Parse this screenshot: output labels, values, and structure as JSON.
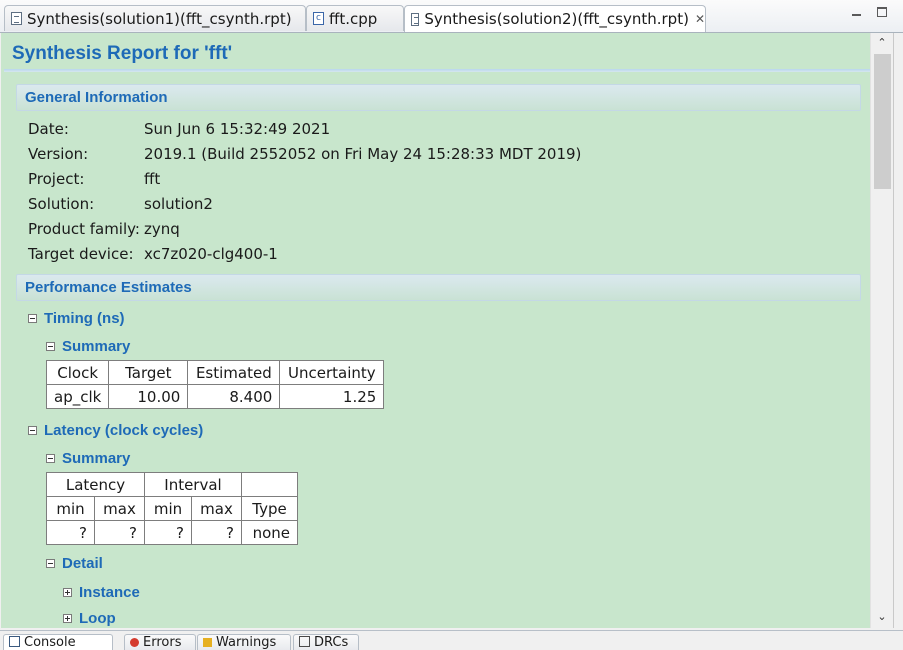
{
  "tabs": [
    {
      "label": "Synthesis(solution1)(fft_csynth.rpt)",
      "icon": "report-icon",
      "active": false
    },
    {
      "label": "fft.cpp",
      "icon": "cpp-file-icon",
      "active": false
    },
    {
      "label": "Synthesis(solution2)(fft_csynth.rpt)",
      "icon": "report-icon",
      "active": true,
      "close": "✕"
    }
  ],
  "report": {
    "title": "Synthesis Report for 'fft'",
    "general": {
      "heading": "General Information",
      "rows": [
        {
          "label": "Date:",
          "value": "Sun Jun 6 15:32:49 2021"
        },
        {
          "label": "Version:",
          "value": "2019.1 (Build 2552052 on Fri May 24 15:28:33 MDT 2019)"
        },
        {
          "label": "Project:",
          "value": "fft"
        },
        {
          "label": "Solution:",
          "value": "solution2"
        },
        {
          "label": "Product family:",
          "value": "zynq"
        },
        {
          "label": "Target device:",
          "value": "xc7z020-clg400-1"
        }
      ]
    },
    "performance": {
      "heading": "Performance Estimates",
      "timing": {
        "label": "Timing (ns)",
        "summary_label": "Summary",
        "headers": [
          "Clock",
          "Target",
          "Estimated",
          "Uncertainty"
        ],
        "row": [
          "ap_clk",
          "10.00",
          "8.400",
          "1.25"
        ]
      },
      "latency": {
        "label": "Latency (clock cycles)",
        "summary_label": "Summary",
        "group_headers": [
          "Latency",
          "Interval"
        ],
        "headers": [
          "min",
          "max",
          "min",
          "max",
          "Type"
        ],
        "row": [
          "?",
          "?",
          "?",
          "?",
          "none"
        ],
        "detail_label": "Detail",
        "instance_label": "Instance",
        "loop_label": "Loop"
      }
    }
  },
  "bottom_tabs": [
    "Console",
    "Errors",
    "Warnings",
    "DRCs"
  ],
  "colors": {
    "content_bg": "#c8e6cc",
    "heading": "#1e6ab7"
  }
}
